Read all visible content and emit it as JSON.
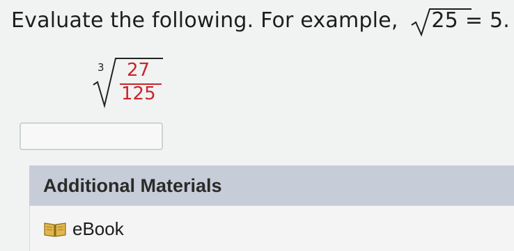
{
  "question": {
    "prompt_text": "Evaluate the following. For example,",
    "example_radicand": "25",
    "example_result": "= 5."
  },
  "expression": {
    "root_index": "3",
    "numerator": "27",
    "denominator": "125",
    "color": "#c8242b"
  },
  "answer": {
    "value": ""
  },
  "additional_materials": {
    "header": "Additional Materials",
    "items": [
      {
        "label": "eBook",
        "icon": "book-icon"
      }
    ]
  }
}
